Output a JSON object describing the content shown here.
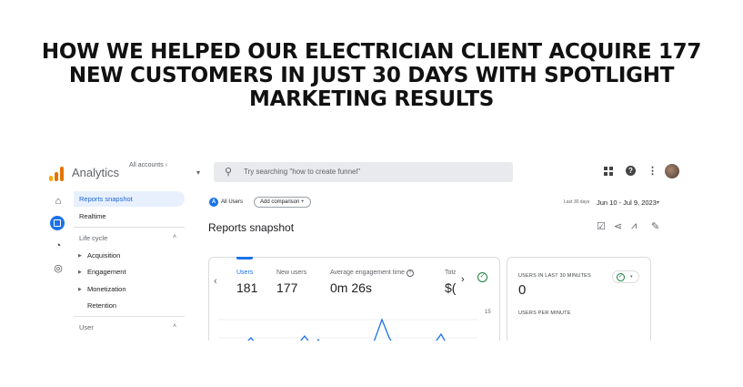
{
  "headline": {
    "line1": "HOW WE HELPED OUR ELECTRICIAN CLIENT ACQUIRE 177",
    "line2": "NEW CUSTOMERS IN JUST 30 DAYS WITH SPOTLIGHT",
    "line3": "MARKETING RESULTS"
  },
  "topbar": {
    "app_name": "Analytics",
    "accounts_label": "All accounts ›",
    "account_caret": "▾",
    "search_icon": "⚲",
    "search_placeholder": "Try searching \"how to create funnel\"",
    "help_glyph": "?",
    "more_glyph": "⋮",
    "icons": [
      "analytics-logo-icon",
      "search-icon",
      "apps-icon",
      "help-icon",
      "more-icon",
      "avatar"
    ]
  },
  "rail": {
    "home_icon": "⌂",
    "insights_icon": "◔",
    "advertising_icon": "◎"
  },
  "nav": {
    "reports_snapshot": "Reports snapshot",
    "realtime": "Realtime",
    "life_cycle": "Life cycle",
    "acquisition": "Acquisition",
    "engagement": "Engagement",
    "monetization": "Monetization",
    "retention": "Retention",
    "user": "User",
    "caret_up": "˄",
    "expand_glyph": "▶"
  },
  "main": {
    "all_users_badge": "A",
    "all_users": "All Users",
    "add_comparison": "Add comparison +",
    "date_label": "Last 30 days",
    "date_range": "Jun 10 - Jul 9, 2023",
    "date_caret": "▾",
    "page_title": "Reports snapshot",
    "tools": {
      "edit_card": "☑",
      "share": "⋖",
      "insights": "⩘",
      "pencil": "✎"
    }
  },
  "metrics_card": {
    "prev_arrow": "‹",
    "next_arrow": "›",
    "check": "✓",
    "help_glyph": "?",
    "metrics": [
      {
        "label": "Users",
        "value": "181"
      },
      {
        "label": "New users",
        "value": "177"
      },
      {
        "label": "Average engagement time",
        "value": "0m 26s"
      },
      {
        "label": "Tota",
        "value": "$("
      }
    ],
    "y_tick": "15"
  },
  "realtime_card": {
    "label": "USERS IN LAST 30 MINUTES",
    "value": "0",
    "per_minute_label": "USERS PER MINUTE",
    "status_check": "✓",
    "status_caret": "▾"
  }
}
